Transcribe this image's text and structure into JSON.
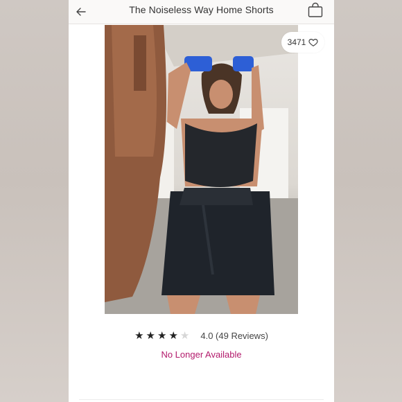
{
  "header": {
    "title": "The Noiseless Way Home Shorts",
    "back_icon": "arrow-left-icon",
    "bag_icon": "shopping-bag-icon"
  },
  "photo": {
    "likes": "3471",
    "heart_icon": "heart-outline-icon"
  },
  "rating": {
    "stars_filled": 4,
    "stars_total": 5,
    "text": "4.0 (49 Reviews)"
  },
  "status": {
    "text": "No Longer Available",
    "color": "#b2196b"
  }
}
